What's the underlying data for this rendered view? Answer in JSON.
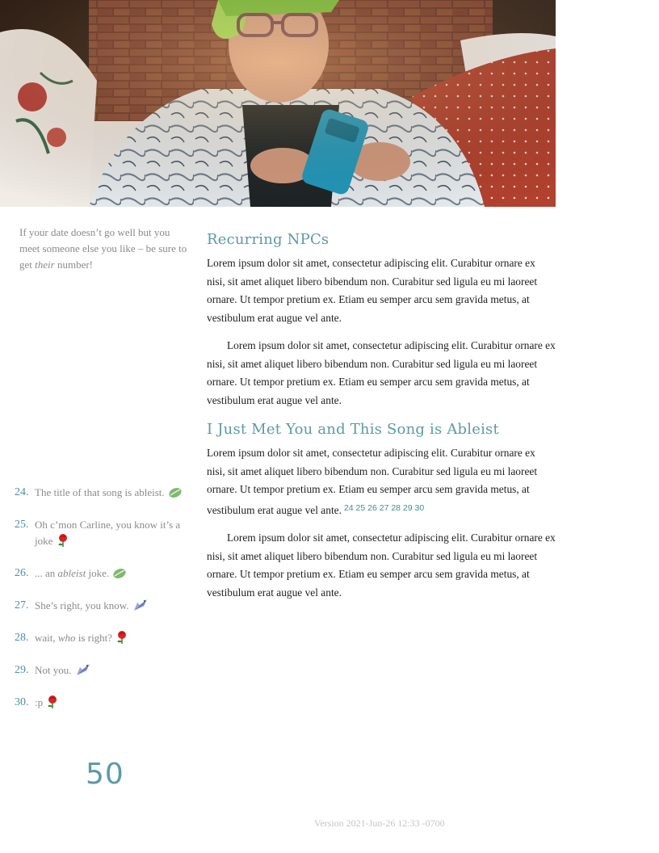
{
  "sidebar_note": {
    "text_before": "If your date doesn’t go well but you meet someone else you like – be sure to get ",
    "emphasis": "their",
    "text_after": " number!"
  },
  "sections": [
    {
      "heading": "Recurring NPCs",
      "paragraphs": [
        "Lorem ipsum dolor sit amet, consectetur adipiscing elit. Curabitur ornare ex nisi, sit amet aliquet libero bibendum non. Curabitur sed ligula eu mi laoreet ornare. Ut tempor pretium ex. Etiam eu semper arcu sem gravida metus, at vestibulum erat augue vel ante.",
        "Lorem ipsum dolor sit amet, consectetur adipiscing elit. Curabitur ornare ex nisi, sit amet aliquet libero bibendum non. Curabitur sed ligula eu mi laoreet ornare. Ut tempor pretium ex. Etiam eu semper arcu sem gravida metus, at vestibulum erat augue vel ante."
      ]
    },
    {
      "heading": "I Just Met You and This Song is Ableist",
      "paragraphs": [
        "Lorem ipsum dolor sit amet, consectetur adipiscing elit. Curabitur ornare ex nisi, sit amet aliquet libero bibendum non. Curabitur sed ligula eu mi laoreet ornare. Ut tempor pretium ex. Etiam eu semper arcu sem gravida metus, at vestibulum erat augue vel ante.",
        "Lorem ipsum dolor sit amet, consectetur adipiscing elit. Curabitur ornare ex nisi, sit amet aliquet libero bibendum non. Curabitur sed ligula eu mi laoreet ornare. Ut tempor pretium ex. Etiam eu semper arcu sem gravida metus, at vestibulum erat augue vel ante."
      ],
      "footnote_refs": "24 25 26 27 28 29 30"
    }
  ],
  "footnotes": [
    {
      "num": "24.",
      "before": "The title of that song is ableist.",
      "em": "",
      "after": "",
      "icon": "leaf-icon"
    },
    {
      "num": "25.",
      "before": "Oh c’mon Carline, you know it’s a joke",
      "em": "",
      "after": "",
      "icon": "rose-icon"
    },
    {
      "num": "26.",
      "before": "... an ",
      "em": "ableist",
      "after": " joke.",
      "icon": "leaf-icon"
    },
    {
      "num": "27.",
      "before": "She’s right, you know.",
      "em": "",
      "after": "",
      "icon": "bird-icon"
    },
    {
      "num": "28.",
      "before": "wait, ",
      "em": "who",
      "after": " is right?",
      "icon": "rose-icon"
    },
    {
      "num": "29.",
      "before": "Not you.",
      "em": "",
      "after": "",
      "icon": "bird-icon"
    },
    {
      "num": "30.",
      "before": ":p",
      "em": "",
      "after": "",
      "icon": "rose-icon"
    }
  ],
  "page_number": "50",
  "version": "Version 2021-Jun-26 12:33 -0700",
  "colors": {
    "heading": "#5b9aa6",
    "footnote_number": "#4f8fa3",
    "muted_text": "#8a8a8a"
  }
}
